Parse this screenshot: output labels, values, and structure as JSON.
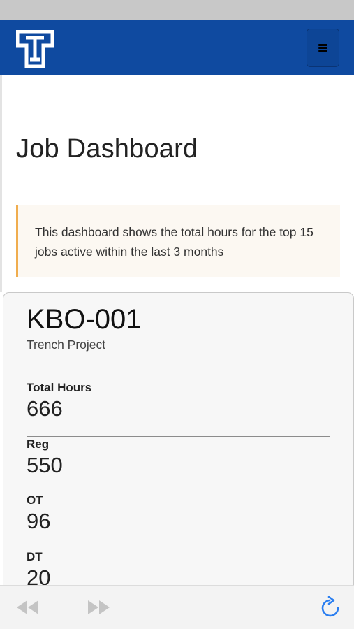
{
  "header": {
    "logo_icon": "t-logo-icon",
    "menu_icon": "hamburger-menu-icon",
    "brand_color": "#0f4aa0"
  },
  "page": {
    "title": "Job Dashboard",
    "info_text": "This dashboard shows the total hours for the top 15 jobs active within the last 3 months",
    "info_accent": "#f0ad4e"
  },
  "job_card": {
    "code": "KBO-001",
    "name": "Trench Project",
    "stats": [
      {
        "label": "Total Hours",
        "value": "666"
      },
      {
        "label": "Reg",
        "value": "550"
      },
      {
        "label": "OT",
        "value": "96"
      },
      {
        "label": "DT",
        "value": "20"
      }
    ]
  },
  "browser_toolbar": {
    "back_icon": "back-arrow-icon",
    "forward_icon": "forward-arrow-icon",
    "reload_icon": "reload-icon",
    "reload_color": "#2a7ef0"
  }
}
